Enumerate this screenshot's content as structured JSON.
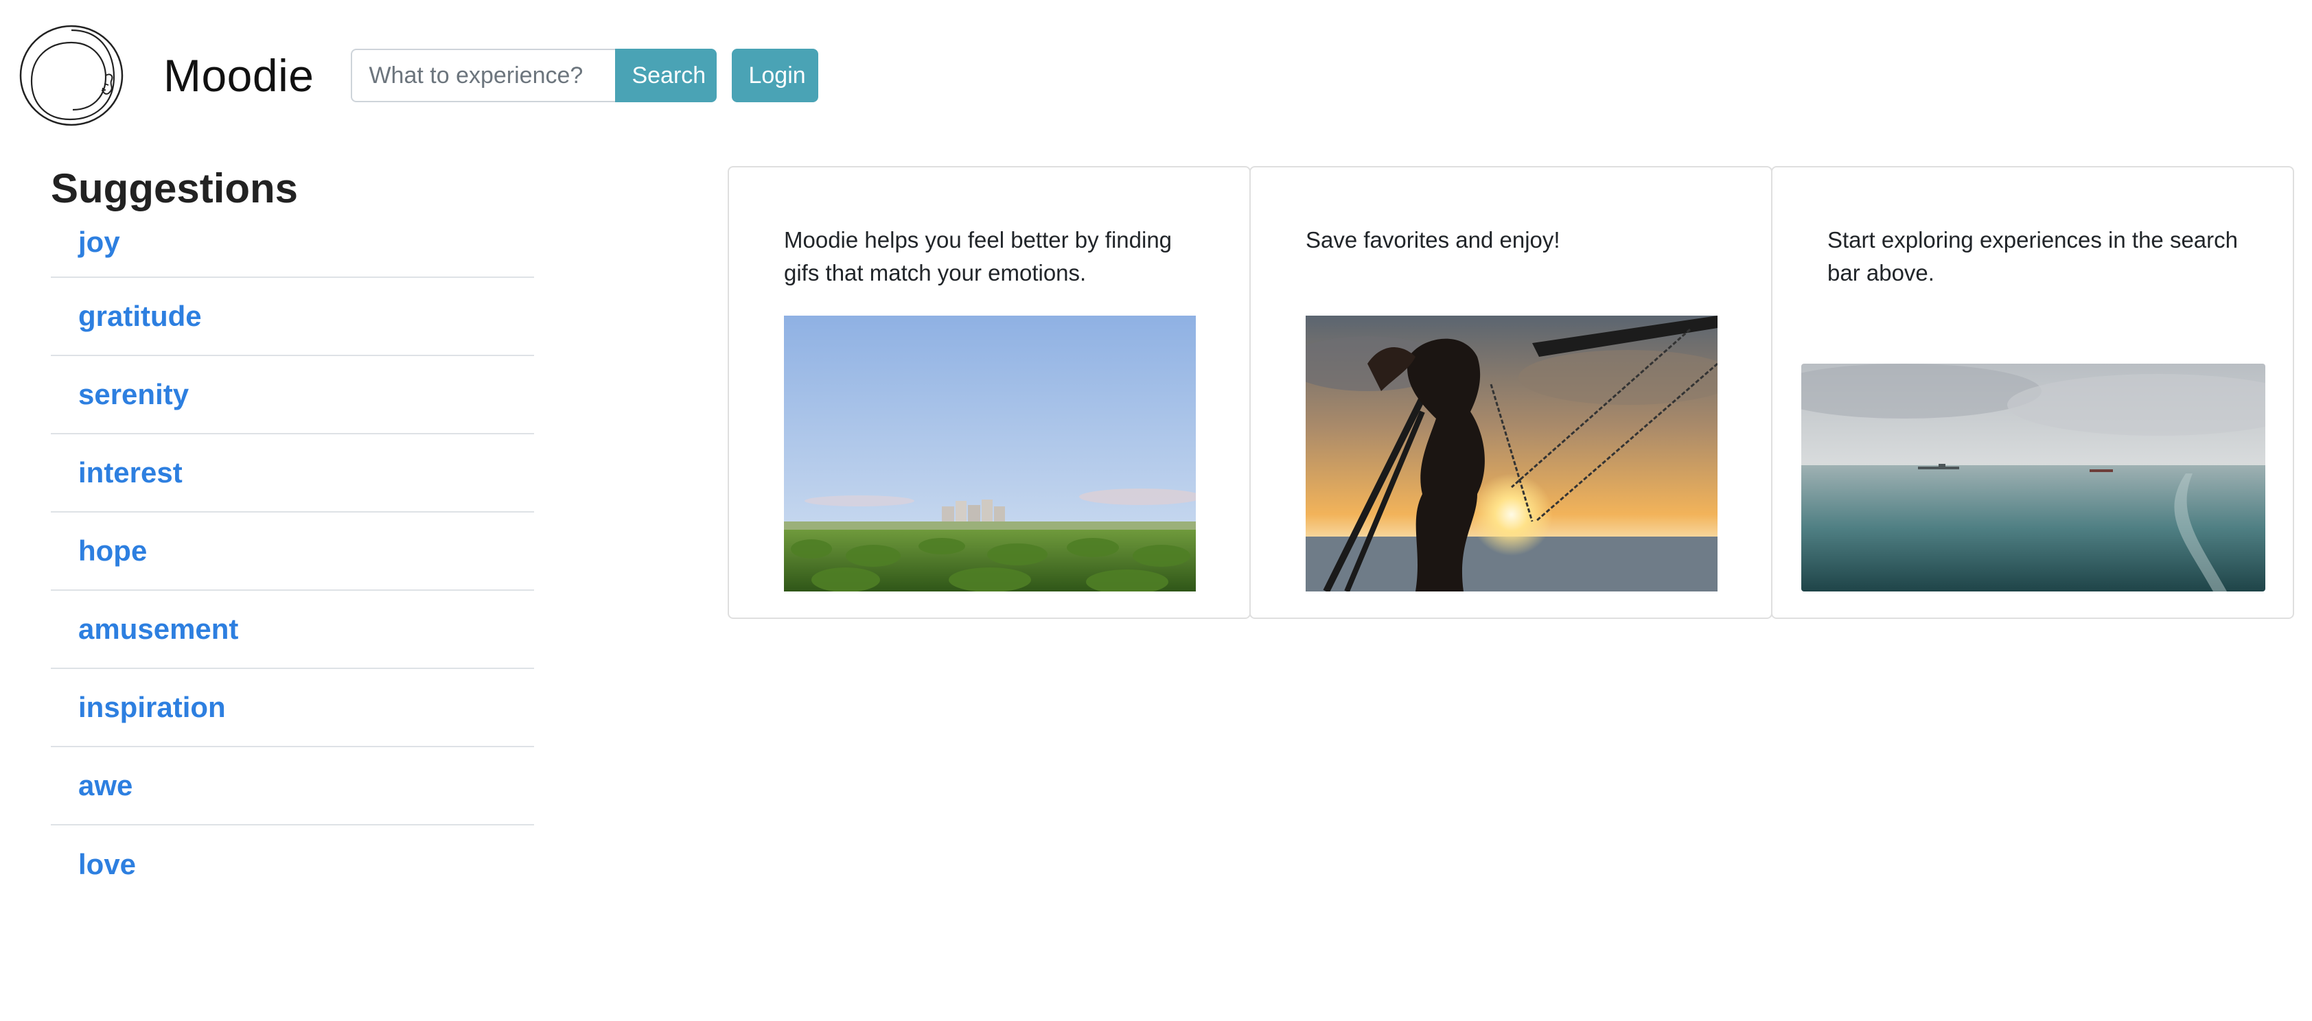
{
  "brand": {
    "name": "Moodie"
  },
  "search": {
    "placeholder": "What to experience?",
    "button_label": "Search"
  },
  "login": {
    "label": "Login"
  },
  "suggestions": {
    "title": "Suggestions",
    "items": [
      "joy",
      "gratitude",
      "serenity",
      "interest",
      "hope",
      "amusement",
      "inspiration",
      "awe",
      "love"
    ]
  },
  "cards": [
    {
      "text": "Moodie helps you feel better by finding gifs that match your emotions.",
      "image": "field-with-city-skyline"
    },
    {
      "text": "Save favorites and enjoy!",
      "image": "girl-on-swing-at-sunset"
    },
    {
      "text": "Start exploring experiences in the search bar above.",
      "image": "calm-sea-with-ships"
    }
  ],
  "colors": {
    "accent_button": "#4aa3b5",
    "link": "#2d7fe0",
    "card_border": "#dfdfdf"
  }
}
